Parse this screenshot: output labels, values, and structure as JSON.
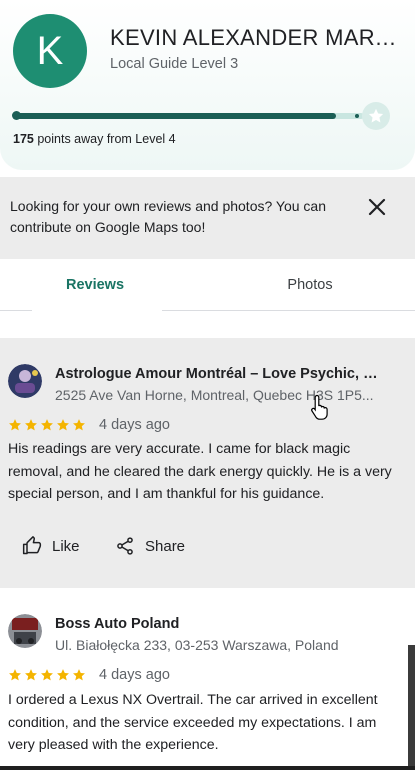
{
  "profile": {
    "avatar_letter": "K",
    "avatar_color": "#1e8e72",
    "name": "KEVIN ALEXANDER MART...",
    "level": "Local Guide Level 3",
    "points_number": "175",
    "points_suffix": " points away from Level 4",
    "progress_fraction": 0.92
  },
  "banner": {
    "text": "Looking for your own reviews and photos? You can contribute on Google Maps too!",
    "close_icon": "close-icon"
  },
  "tabs": [
    {
      "label": "Reviews",
      "selected": true
    },
    {
      "label": "Photos",
      "selected": false
    }
  ],
  "reviews": [
    {
      "place_name": "Astrologue Amour Montréal – Love Psychic, R...",
      "address": "2525 Ave Van Horne, Montreal, Quebec H3S 1P5...",
      "rating": 5,
      "date": "4 days ago",
      "text": "His readings are very accurate. I came for black magic removal, and he cleared the dark energy quickly. He is a very special person, and I am thankful for his guidance.",
      "like_label": "Like",
      "share_label": "Share"
    },
    {
      "place_name": "Boss Auto Poland",
      "address": "Ul. Białołęcka 233, 03-253 Warszawa, Poland",
      "rating": 5,
      "date": "4 days ago",
      "text": "I ordered a Lexus NX Overtrail. The car arrived in excellent condition, and the service exceeded my expectations. I am very pleased with the experience."
    }
  ],
  "colors": {
    "accent": "#1a7464",
    "star": "#f4b400",
    "banner_bg": "#ececec"
  }
}
